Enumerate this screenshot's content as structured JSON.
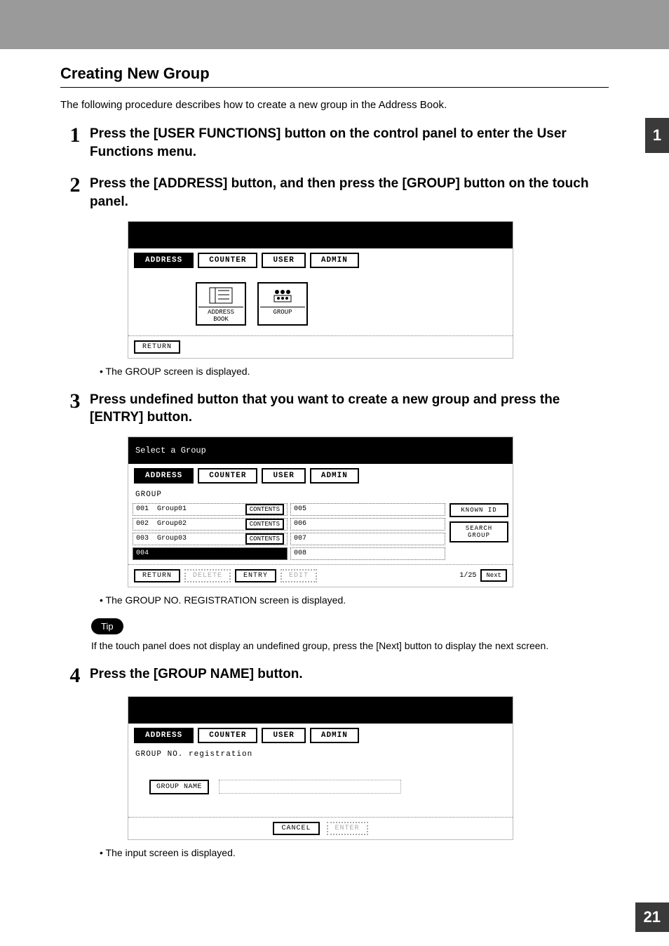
{
  "side_tab": "1",
  "page_number": "21",
  "section_title": "Creating New Group",
  "intro_text": "The following procedure describes how to create a new group in the Address Book.",
  "steps": {
    "s1": {
      "num": "1",
      "heading": "Press the [USER FUNCTIONS] button on the control panel to enter the User Functions menu."
    },
    "s2": {
      "num": "2",
      "heading": "Press the [ADDRESS] button, and then press the [GROUP] button on the touch panel.",
      "bullet": "The GROUP screen is displayed."
    },
    "s3": {
      "num": "3",
      "heading": "Press undefined button that you want to create a new group and press the [ENTRY] button.",
      "bullet": "The GROUP NO. REGISTRATION screen is displayed."
    },
    "s4": {
      "num": "4",
      "heading": "Press the [GROUP NAME] button.",
      "bullet": "The input screen is displayed."
    }
  },
  "tip_label": "Tip",
  "tip_text": "If the touch panel does not display an undefined group, press the [Next] button to display the next screen.",
  "ss_common": {
    "tabs": {
      "address": "ADDRESS",
      "counter": "COUNTER",
      "user": "USER",
      "admin": "ADMIN"
    },
    "return_btn": "RETURN"
  },
  "ss2": {
    "icon_address_book": "ADDRESS BOOK",
    "icon_group": "GROUP"
  },
  "ss3": {
    "title": "Select a Group",
    "subhead": "GROUP",
    "contents_btn": "CONTENTS",
    "known_id_btn": "KNOWN ID",
    "search_group_btn": "SEARCH GROUP",
    "delete_btn": "DELETE",
    "entry_btn": "ENTRY",
    "edit_btn": "EDIT",
    "page_indicator": "1/25",
    "next_btn": "Next",
    "slots_left": [
      {
        "id": "001",
        "name": "Group01",
        "has_contents": true
      },
      {
        "id": "002",
        "name": "Group02",
        "has_contents": true
      },
      {
        "id": "003",
        "name": "Group03",
        "has_contents": true
      },
      {
        "id": "004",
        "name": "",
        "has_contents": false,
        "selected": true
      }
    ],
    "slots_right": [
      {
        "id": "005",
        "name": "",
        "has_contents": false
      },
      {
        "id": "006",
        "name": "",
        "has_contents": false
      },
      {
        "id": "007",
        "name": "",
        "has_contents": false
      },
      {
        "id": "008",
        "name": "",
        "has_contents": false
      }
    ]
  },
  "ss4": {
    "subhead": "GROUP NO. registration",
    "group_name_btn": "GROUP NAME",
    "cancel_btn": "CANCEL",
    "enter_btn": "ENTER"
  }
}
